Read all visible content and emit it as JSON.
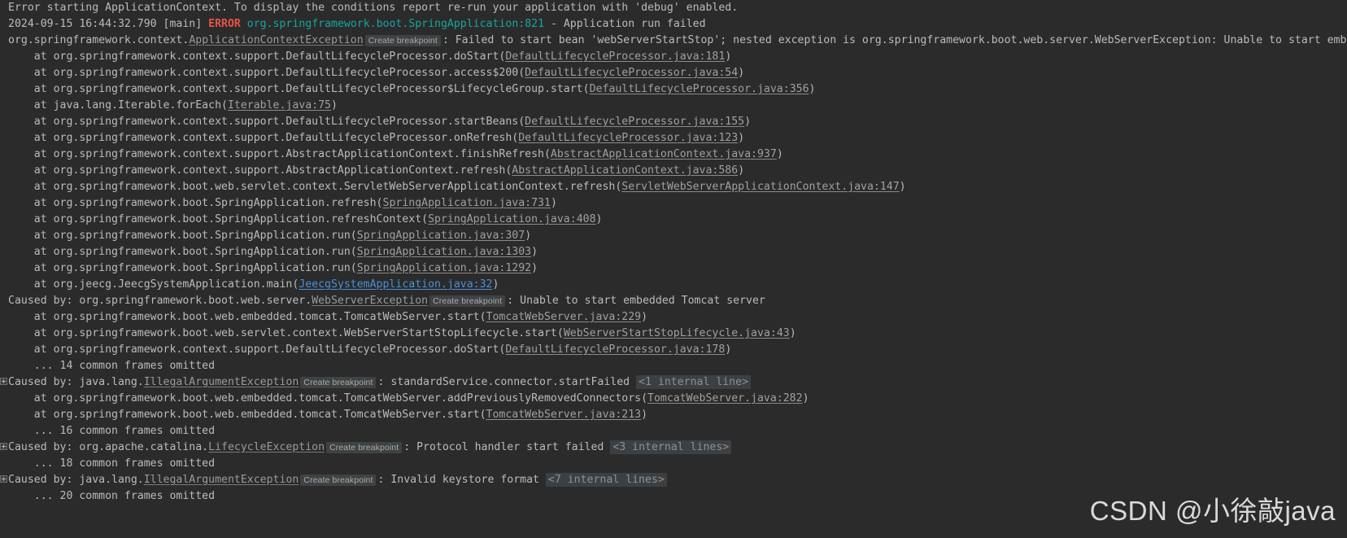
{
  "app": {
    "name": "IntelliJ IDEA Run Console",
    "theme": "darcula",
    "background_color": "#2b2b2b",
    "foreground_color": "#bbbbbb",
    "error_color": "#e8534a",
    "logger_color": "#17a5a0",
    "link_color": "#a0a0a0",
    "active_link_color": "#4a90d9",
    "badge_bg_color": "#3f4244"
  },
  "labels": {
    "create_breakpoint": "Create breakpoint",
    "fold_icon": "expand-fold-plus-icon"
  },
  "watermark": {
    "text": "CSDN @小徐敲java"
  },
  "console": {
    "lines": [
      {
        "id": "l1",
        "gutter": "none",
        "segments": [
          {
            "kind": "txt",
            "text": "Error starting ApplicationContext. To display the conditions report re-run your application with 'debug' enabled."
          }
        ]
      },
      {
        "id": "l2",
        "gutter": "none",
        "segments": [
          {
            "kind": "txt",
            "text": "2024-09-15 16:44:32.790 [main] "
          },
          {
            "kind": "err",
            "text": "ERROR"
          },
          {
            "kind": "txt",
            "text": " "
          },
          {
            "kind": "logger",
            "text": "org.springframework.boot.SpringApplication:821"
          },
          {
            "kind": "txt",
            "text": " - Application run failed"
          }
        ]
      },
      {
        "id": "l3",
        "gutter": "none",
        "segments": [
          {
            "kind": "txt",
            "text": "org.springframework.context."
          },
          {
            "kind": "exc",
            "text": "ApplicationContextException"
          },
          {
            "kind": "bp",
            "text": "Create breakpoint"
          },
          {
            "kind": "txt",
            "text": ": Failed to start bean 'webServerStartStop'; nested exception is org.springframework.boot.web.server.WebServerException: Unable to start embedded Tomcat server"
          }
        ]
      },
      {
        "id": "l4",
        "gutter": "none",
        "segments": [
          {
            "kind": "txt",
            "text": "    at org.springframework.context.support.DefaultLifecycleProcessor.doStart("
          },
          {
            "kind": "link",
            "text": "DefaultLifecycleProcessor.java:181"
          },
          {
            "kind": "txt",
            "text": ")"
          }
        ]
      },
      {
        "id": "l5",
        "gutter": "none",
        "segments": [
          {
            "kind": "txt",
            "text": "    at org.springframework.context.support.DefaultLifecycleProcessor.access$200("
          },
          {
            "kind": "link",
            "text": "DefaultLifecycleProcessor.java:54"
          },
          {
            "kind": "txt",
            "text": ")"
          }
        ]
      },
      {
        "id": "l6",
        "gutter": "none",
        "segments": [
          {
            "kind": "txt",
            "text": "    at org.springframework.context.support.DefaultLifecycleProcessor$LifecycleGroup.start("
          },
          {
            "kind": "link",
            "text": "DefaultLifecycleProcessor.java:356"
          },
          {
            "kind": "txt",
            "text": ")"
          }
        ]
      },
      {
        "id": "l7",
        "gutter": "none",
        "segments": [
          {
            "kind": "txt",
            "text": "    at java.lang.Iterable.forEach("
          },
          {
            "kind": "link",
            "text": "Iterable.java:75"
          },
          {
            "kind": "txt",
            "text": ")"
          }
        ]
      },
      {
        "id": "l8",
        "gutter": "none",
        "segments": [
          {
            "kind": "txt",
            "text": "    at org.springframework.context.support.DefaultLifecycleProcessor.startBeans("
          },
          {
            "kind": "link",
            "text": "DefaultLifecycleProcessor.java:155"
          },
          {
            "kind": "txt",
            "text": ")"
          }
        ]
      },
      {
        "id": "l9",
        "gutter": "none",
        "segments": [
          {
            "kind": "txt",
            "text": "    at org.springframework.context.support.DefaultLifecycleProcessor.onRefresh("
          },
          {
            "kind": "link",
            "text": "DefaultLifecycleProcessor.java:123"
          },
          {
            "kind": "txt",
            "text": ")"
          }
        ]
      },
      {
        "id": "l10",
        "gutter": "none",
        "segments": [
          {
            "kind": "txt",
            "text": "    at org.springframework.context.support.AbstractApplicationContext.finishRefresh("
          },
          {
            "kind": "link",
            "text": "AbstractApplicationContext.java:937"
          },
          {
            "kind": "txt",
            "text": ")"
          }
        ]
      },
      {
        "id": "l11",
        "gutter": "none",
        "segments": [
          {
            "kind": "txt",
            "text": "    at org.springframework.context.support.AbstractApplicationContext.refresh("
          },
          {
            "kind": "link",
            "text": "AbstractApplicationContext.java:586"
          },
          {
            "kind": "txt",
            "text": ")"
          }
        ]
      },
      {
        "id": "l12",
        "gutter": "none",
        "segments": [
          {
            "kind": "txt",
            "text": "    at org.springframework.boot.web.servlet.context.ServletWebServerApplicationContext.refresh("
          },
          {
            "kind": "link",
            "text": "ServletWebServerApplicationContext.java:147"
          },
          {
            "kind": "txt",
            "text": ")"
          }
        ]
      },
      {
        "id": "l13",
        "gutter": "none",
        "segments": [
          {
            "kind": "txt",
            "text": "    at org.springframework.boot.SpringApplication.refresh("
          },
          {
            "kind": "link",
            "text": "SpringApplication.java:731"
          },
          {
            "kind": "txt",
            "text": ")"
          }
        ]
      },
      {
        "id": "l14",
        "gutter": "none",
        "segments": [
          {
            "kind": "txt",
            "text": "    at org.springframework.boot.SpringApplication.refreshContext("
          },
          {
            "kind": "link",
            "text": "SpringApplication.java:408"
          },
          {
            "kind": "txt",
            "text": ")"
          }
        ]
      },
      {
        "id": "l15",
        "gutter": "none",
        "segments": [
          {
            "kind": "txt",
            "text": "    at org.springframework.boot.SpringApplication.run("
          },
          {
            "kind": "link",
            "text": "SpringApplication.java:307"
          },
          {
            "kind": "txt",
            "text": ")"
          }
        ]
      },
      {
        "id": "l16",
        "gutter": "none",
        "segments": [
          {
            "kind": "txt",
            "text": "    at org.springframework.boot.SpringApplication.run("
          },
          {
            "kind": "link",
            "text": "SpringApplication.java:1303"
          },
          {
            "kind": "txt",
            "text": ")"
          }
        ]
      },
      {
        "id": "l17",
        "gutter": "none",
        "segments": [
          {
            "kind": "txt",
            "text": "    at org.springframework.boot.SpringApplication.run("
          },
          {
            "kind": "link",
            "text": "SpringApplication.java:1292"
          },
          {
            "kind": "txt",
            "text": ")"
          }
        ]
      },
      {
        "id": "l18",
        "gutter": "none",
        "segments": [
          {
            "kind": "txt",
            "text": "    at org.jeecg.JeecgSystemApplication.main("
          },
          {
            "kind": "link-active",
            "text": "JeecgSystemApplication.java:32"
          },
          {
            "kind": "txt",
            "text": ")"
          }
        ]
      },
      {
        "id": "l19",
        "gutter": "none",
        "segments": [
          {
            "kind": "txt",
            "text": "Caused by: org.springframework.boot.web.server."
          },
          {
            "kind": "exc",
            "text": "WebServerException"
          },
          {
            "kind": "bp",
            "text": "Create breakpoint"
          },
          {
            "kind": "txt",
            "text": ": Unable to start embedded Tomcat server"
          }
        ]
      },
      {
        "id": "l20",
        "gutter": "none",
        "segments": [
          {
            "kind": "txt",
            "text": "    at org.springframework.boot.web.embedded.tomcat.TomcatWebServer.start("
          },
          {
            "kind": "link",
            "text": "TomcatWebServer.java:229"
          },
          {
            "kind": "txt",
            "text": ")"
          }
        ]
      },
      {
        "id": "l21",
        "gutter": "none",
        "segments": [
          {
            "kind": "txt",
            "text": "    at org.springframework.boot.web.servlet.context.WebServerStartStopLifecycle.start("
          },
          {
            "kind": "link",
            "text": "WebServerStartStopLifecycle.java:43"
          },
          {
            "kind": "txt",
            "text": ")"
          }
        ]
      },
      {
        "id": "l22",
        "gutter": "none",
        "segments": [
          {
            "kind": "txt",
            "text": "    at org.springframework.context.support.DefaultLifecycleProcessor.doStart("
          },
          {
            "kind": "link",
            "text": "DefaultLifecycleProcessor.java:178"
          },
          {
            "kind": "txt",
            "text": ")"
          }
        ]
      },
      {
        "id": "l23",
        "gutter": "none",
        "segments": [
          {
            "kind": "txt",
            "text": "    ... 14 common frames omitted"
          }
        ]
      },
      {
        "id": "l24",
        "gutter": "fold",
        "segments": [
          {
            "kind": "txt",
            "text": "Caused by: java.lang."
          },
          {
            "kind": "exc",
            "text": "IllegalArgumentException"
          },
          {
            "kind": "bp",
            "text": "Create breakpoint"
          },
          {
            "kind": "txt",
            "text": ": standardService.connector.startFailed "
          },
          {
            "kind": "fold-badge",
            "text": "<1 internal line>"
          }
        ]
      },
      {
        "id": "l25",
        "gutter": "none",
        "segments": [
          {
            "kind": "txt",
            "text": "    at org.springframework.boot.web.embedded.tomcat.TomcatWebServer.addPreviouslyRemovedConnectors("
          },
          {
            "kind": "link",
            "text": "TomcatWebServer.java:282"
          },
          {
            "kind": "txt",
            "text": ")"
          }
        ]
      },
      {
        "id": "l26",
        "gutter": "none",
        "segments": [
          {
            "kind": "txt",
            "text": "    at org.springframework.boot.web.embedded.tomcat.TomcatWebServer.start("
          },
          {
            "kind": "link",
            "text": "TomcatWebServer.java:213"
          },
          {
            "kind": "txt",
            "text": ")"
          }
        ]
      },
      {
        "id": "l27",
        "gutter": "none",
        "segments": [
          {
            "kind": "txt",
            "text": "    ... 16 common frames omitted"
          }
        ]
      },
      {
        "id": "l28",
        "gutter": "fold",
        "segments": [
          {
            "kind": "txt",
            "text": "Caused by: org.apache.catalina."
          },
          {
            "kind": "exc",
            "text": "LifecycleException"
          },
          {
            "kind": "bp",
            "text": "Create breakpoint"
          },
          {
            "kind": "txt",
            "text": ": Protocol handler start failed "
          },
          {
            "kind": "fold-badge",
            "text": "<3 internal lines>"
          }
        ]
      },
      {
        "id": "l29",
        "gutter": "none",
        "segments": [
          {
            "kind": "txt",
            "text": "    ... 18 common frames omitted"
          }
        ]
      },
      {
        "id": "l30",
        "gutter": "fold",
        "segments": [
          {
            "kind": "txt",
            "text": "Caused by: java.lang."
          },
          {
            "kind": "exc",
            "text": "IllegalArgumentException"
          },
          {
            "kind": "bp",
            "text": "Create breakpoint"
          },
          {
            "kind": "txt",
            "text": ": Invalid keystore format "
          },
          {
            "kind": "fold-badge",
            "text": "<7 internal lines>"
          }
        ]
      },
      {
        "id": "l31",
        "gutter": "none",
        "segments": [
          {
            "kind": "txt",
            "text": "    ... 20 common frames omitted"
          }
        ]
      }
    ]
  }
}
